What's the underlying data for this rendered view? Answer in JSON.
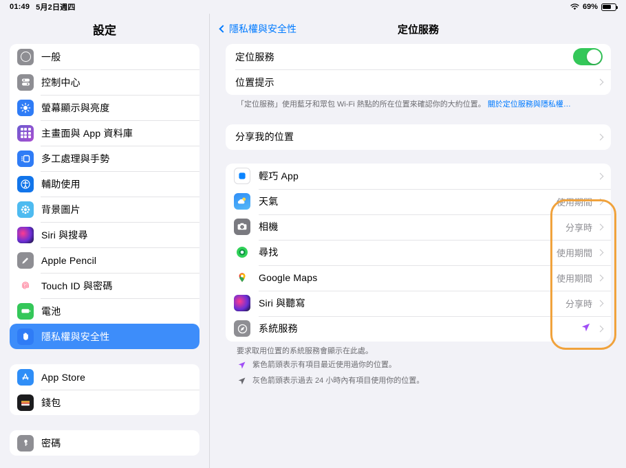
{
  "statusbar": {
    "time": "01:49",
    "date": "5月2日週四",
    "wifi_icon": "wifi-icon",
    "battery_percent": "69%",
    "battery_icon": "battery-icon"
  },
  "sidebar": {
    "title": "設定",
    "selected": "隱私權與安全性",
    "groups": [
      {
        "items": [
          {
            "label": "一般",
            "icon": "gear-icon"
          },
          {
            "label": "控制中心",
            "icon": "control-center-icon"
          },
          {
            "label": "螢幕顯示與亮度",
            "icon": "display-brightness-icon"
          },
          {
            "label": "主畫面與 App 資料庫",
            "icon": "home-screen-icon"
          },
          {
            "label": "多工處理與手勢",
            "icon": "multitasking-icon"
          },
          {
            "label": "輔助使用",
            "icon": "accessibility-icon"
          },
          {
            "label": "背景圖片",
            "icon": "wallpaper-icon"
          },
          {
            "label": "Siri 與搜尋",
            "icon": "siri-icon"
          },
          {
            "label": "Apple Pencil",
            "icon": "apple-pencil-icon"
          },
          {
            "label": "Touch ID 與密碼",
            "icon": "touch-id-icon"
          },
          {
            "label": "電池",
            "icon": "battery-icon"
          },
          {
            "label": "隱私權與安全性",
            "icon": "privacy-hand-icon"
          }
        ]
      },
      {
        "items": [
          {
            "label": "App Store",
            "icon": "app-store-icon"
          },
          {
            "label": "錢包",
            "icon": "wallet-icon"
          }
        ]
      },
      {
        "items": [
          {
            "label": "密碼",
            "icon": "passwords-key-icon"
          }
        ]
      }
    ]
  },
  "main": {
    "back_label": "隱私權與安全性",
    "back_icon": "chevron-left-icon",
    "title": "定位服務",
    "section1": {
      "rows": [
        {
          "label": "定位服務",
          "control": "toggle",
          "toggle_on": true
        },
        {
          "label": "位置提示",
          "control": "chevron"
        }
      ],
      "footer_text": "「定位服務」使用藍牙和眾包 Wi-Fi 熱點的所在位置來確認你的大約位置。",
      "footer_link": "關於定位服務與隱私權…"
    },
    "section2": {
      "rows": [
        {
          "label": "分享我的位置",
          "control": "chevron"
        }
      ]
    },
    "section3": {
      "rows": [
        {
          "label": "輕巧 App",
          "icon": "app-clip-icon",
          "value": "",
          "control": "chevron"
        },
        {
          "label": "天氣",
          "icon": "weather-icon",
          "value": "使用期間",
          "control": "chevron"
        },
        {
          "label": "相機",
          "icon": "camera-icon",
          "value": "分享時",
          "control": "chevron"
        },
        {
          "label": "尋找",
          "icon": "find-my-icon",
          "value": "使用期間",
          "control": "chevron"
        },
        {
          "label": "Google Maps",
          "icon": "google-maps-icon",
          "value": "使用期間",
          "control": "chevron"
        },
        {
          "label": "Siri 與聽寫",
          "icon": "siri-icon",
          "value": "分享時",
          "control": "chevron"
        },
        {
          "label": "系統服務",
          "icon": "system-services-icon",
          "value": "",
          "value_icon": "purple-arrow-icon",
          "control": "chevron"
        }
      ],
      "footer_text": "要求取用位置的系統服務會顯示在此處。",
      "legend": [
        {
          "icon": "purple-arrow-icon",
          "text": "紫色箭頭表示有項目最近使用過你的位置。"
        },
        {
          "icon": "gray-arrow-icon",
          "text": "灰色箭頭表示過去 24 小時內有項目使用你的位置。"
        }
      ]
    }
  },
  "annotation": {
    "name": "orange-highlight-box",
    "color": "#f0a23c"
  }
}
